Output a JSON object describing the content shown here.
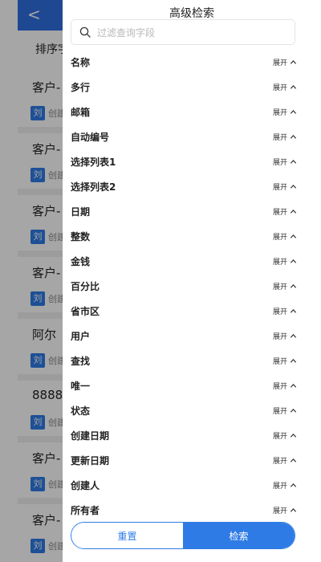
{
  "background": {
    "back_glyph": "<",
    "sort_label": "排序字",
    "cards": [
      {
        "title": "客户-",
        "avatar": "刘",
        "sub": "创建"
      },
      {
        "title": "客户-",
        "avatar": "刘",
        "sub": "创建"
      },
      {
        "title": "客户-",
        "avatar": "刘",
        "sub": "创建"
      },
      {
        "title": "客户-",
        "avatar": "刘",
        "sub": "创建"
      },
      {
        "title": "阿尔",
        "avatar": "刘",
        "sub": "创建"
      },
      {
        "title": "8888",
        "avatar": "刘",
        "sub": "创建"
      },
      {
        "title": "客户-",
        "avatar": "刘",
        "sub": "创建"
      },
      {
        "title": "客户-",
        "avatar": "刘",
        "sub": "创建"
      }
    ]
  },
  "drawer": {
    "title": "高级检索",
    "search": {
      "placeholder": "过滤查询字段",
      "value": ""
    },
    "expand_label": "展开",
    "fields": [
      "名称",
      "多行",
      "邮箱",
      "自动编号",
      "选择列表1",
      "选择列表2",
      "日期",
      "整数",
      "金钱",
      "百分比",
      "省市区",
      "用户",
      "查找",
      "唯一",
      "状态",
      "创建日期",
      "更新日期",
      "创建人",
      "所有者"
    ],
    "reset_label": "重置",
    "search_label": "检索"
  },
  "colors": {
    "accent": "#2f7be6",
    "overlay": "rgba(0,0,0,0.35)"
  }
}
